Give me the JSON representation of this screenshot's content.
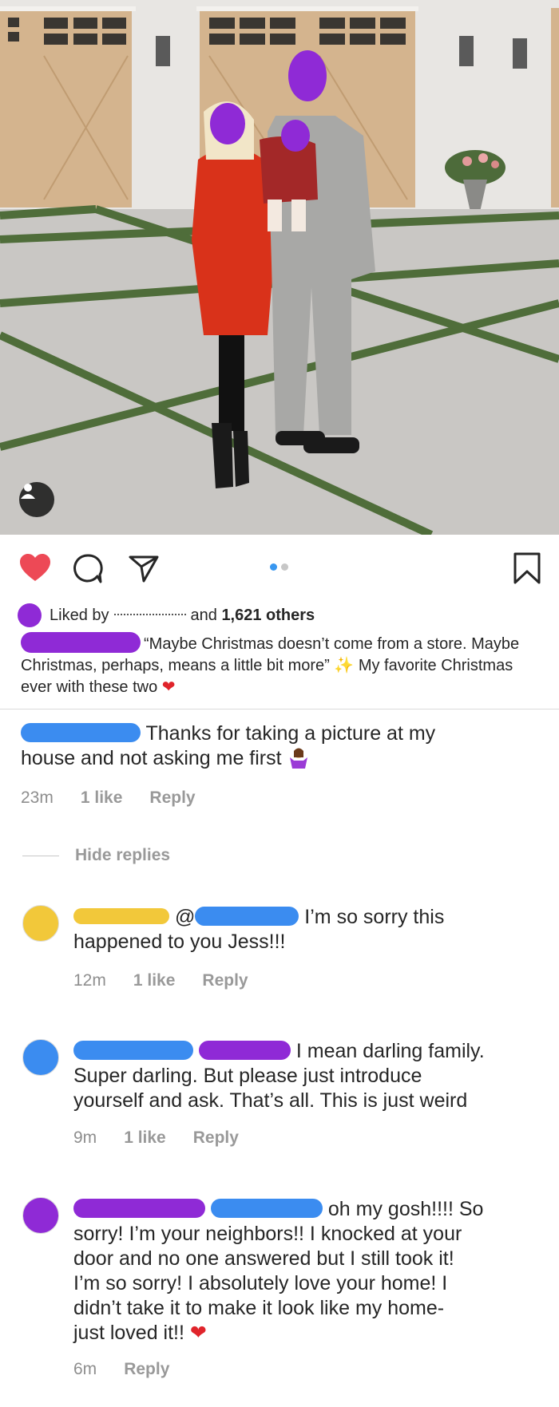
{
  "post": {
    "likes": {
      "prefix": "Liked by",
      "suffix": "and",
      "count": "1,621 others"
    },
    "caption": {
      "text": "“Maybe Christmas doesn’t come from a store. Maybe Christmas, perhaps, means a little bit more”",
      "text2": "My favorite Christmas ever with these two"
    },
    "icons": [
      "heart-icon",
      "comment-icon",
      "share-icon",
      "bookmark-icon",
      "user-tag-icon"
    ],
    "colors": {
      "heart": "#ed4956",
      "dot_active": "#3897f0",
      "redact_purple": "#8f2ad6",
      "redact_blue": "#3b8cf0",
      "redact_yellow": "#f2c83a"
    }
  },
  "comments": [
    {
      "text1": "Thanks for taking a picture at my",
      "text2": "house and not asking me first",
      "time": "23m",
      "likes": "1 like",
      "reply": "Reply"
    }
  ],
  "hide_replies": "Hide replies",
  "replies": [
    {
      "text1": "I’m so sorry this",
      "text2": "happened to you Jess!!!",
      "time": "12m",
      "likes": "1 like",
      "reply": "Reply"
    },
    {
      "text1": "I mean darling family.",
      "text2": "Super darling. But please just introduce",
      "text3": "yourself and ask. That’s all. This is just weird",
      "time": "9m",
      "likes": "1 like",
      "reply": "Reply"
    },
    {
      "text1": "oh my gosh!!!! So",
      "text2": "sorry! I’m your neighbors!! I knocked at your",
      "text3": "door and no one answered but I still took it!",
      "text4": "I’m so sorry! I absolutely love your home! I",
      "text5": "didn’t take it to make it look like my home-",
      "text6": "just loved it!!",
      "time": "6m",
      "reply": "Reply"
    }
  ]
}
